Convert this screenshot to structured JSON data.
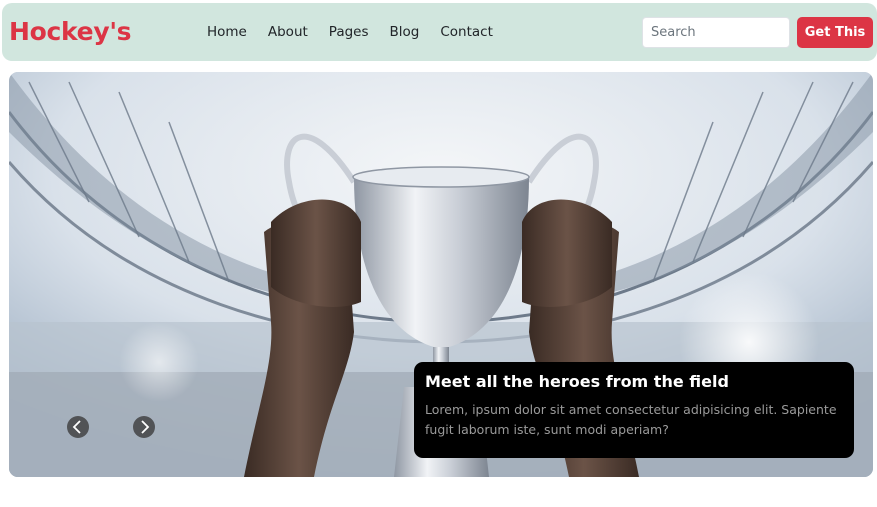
{
  "navbar": {
    "brand": "Hockey's",
    "links": [
      "Home",
      "About",
      "Pages",
      "Blog",
      "Contact"
    ],
    "search_placeholder": "Search",
    "cta_label": "Get This"
  },
  "hero": {
    "image": "trophy-raised-in-stadium",
    "caption_title": "Meet all the heroes from the field",
    "caption_text": "Lorem, ipsum dolor sit amet consectetur adipisicing elit. Sapiente fugit laborum iste, sunt modi aperiam?"
  },
  "controls": {
    "prev_icon": "chevron-left-icon",
    "next_icon": "chevron-right-icon"
  },
  "colors": {
    "brand": "#dc3545",
    "navbar_bg": "#d1e6de",
    "caption_bg": "#000000"
  }
}
